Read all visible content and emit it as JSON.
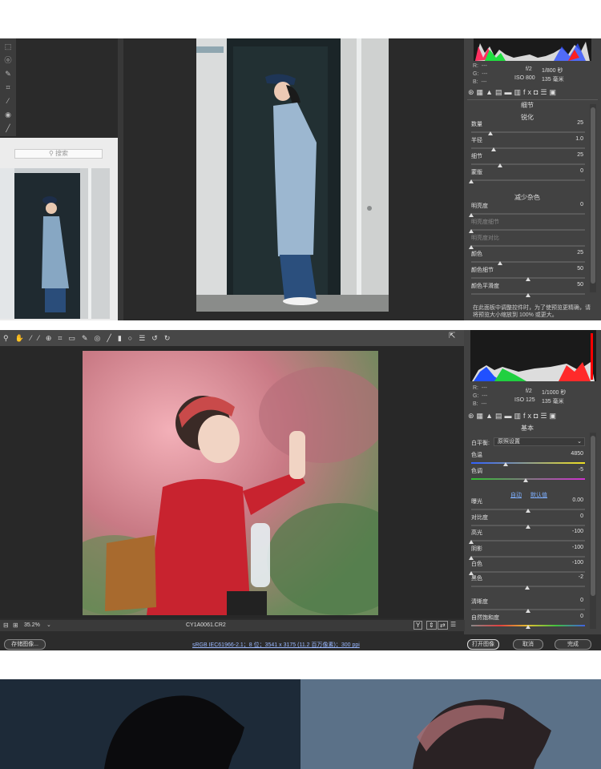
{
  "window1": {
    "search_placeholder": "搜索",
    "info": {
      "r_label": "R:",
      "g_label": "G:",
      "b_label": "B:",
      "r_val": "---",
      "g_val": "---",
      "b_val": "---",
      "aperture": "f/2",
      "shutter": "1/800 秒",
      "iso": "ISO 800",
      "focal": "135 毫米"
    },
    "panel_title": "细节",
    "sharpen_title": "锐化",
    "sharpen": [
      {
        "label": "数量",
        "value": "25",
        "level": 0.17,
        "dim": false
      },
      {
        "label": "半径",
        "value": "1.0",
        "level": 0.2,
        "dim": false
      },
      {
        "label": "细节",
        "value": "25",
        "level": 0.25,
        "dim": false
      },
      {
        "label": "蒙版",
        "value": "0",
        "level": 0.0,
        "dim": false
      }
    ],
    "noise_title": "减少杂色",
    "noise": [
      {
        "label": "明亮度",
        "value": "0",
        "level": 0.0,
        "dim": false
      },
      {
        "label": "明亮度细节",
        "value": "",
        "level": 0.0,
        "dim": true
      },
      {
        "label": "明亮度对比",
        "value": "",
        "level": 0.0,
        "dim": true
      },
      {
        "label": "颜色",
        "value": "25",
        "level": 0.25,
        "dim": false
      },
      {
        "label": "颜色细节",
        "value": "50",
        "level": 0.5,
        "dim": false
      },
      {
        "label": "颜色平滑度",
        "value": "50",
        "level": 0.5,
        "dim": false
      }
    ],
    "note": "在此面板中调整控件时，为了使预览更精确，请将预览大小缩放到 100% 或更大。"
  },
  "window2": {
    "info": {
      "r_label": "R:",
      "g_label": "G:",
      "b_label": "B:",
      "r_val": "---",
      "g_val": "---",
      "b_val": "---",
      "aperture": "f/2",
      "shutter": "1/1000 秒",
      "iso": "ISO 125",
      "focal": "135 毫米"
    },
    "panel_title": "基本",
    "wb_label": "白平衡:",
    "wb_value": "原照设置",
    "auto_label": "自动",
    "default_label": "默认值",
    "basic": [
      {
        "label": "色温",
        "value": "4850",
        "level": 0.3
      },
      {
        "label": "色调",
        "value": "-5",
        "level": 0.48
      },
      {
        "label": "曝光",
        "value": "0.00",
        "level": 0.5
      },
      {
        "label": "对比度",
        "value": "0",
        "level": 0.5
      },
      {
        "label": "高光",
        "value": "-100",
        "level": 0.0
      },
      {
        "label": "阴影",
        "value": "-100",
        "level": 0.0
      },
      {
        "label": "白色",
        "value": "-100",
        "level": 0.0
      },
      {
        "label": "黑色",
        "value": "-2",
        "level": 0.49
      },
      {
        "label": "清晰度",
        "value": "0",
        "level": 0.5
      },
      {
        "label": "自然饱和度",
        "value": "0",
        "level": 0.5
      }
    ],
    "zoom": "35.2%",
    "filename": "CY1A0061.CR2",
    "save_button": "存储图像...",
    "workflow": "sRGB IEC61966-2.1；8 位；3541 x 3175 (11.2 百万像素)；300 ppi",
    "open_button": "打开图像",
    "cancel_button": "取消",
    "done_button": "完成"
  },
  "colors": {
    "panel": "#424242",
    "accent": "#4a90e2"
  }
}
